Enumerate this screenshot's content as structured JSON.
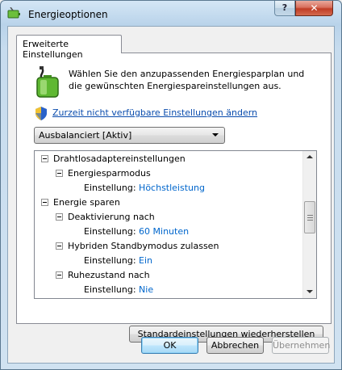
{
  "window": {
    "title": "Energieoptionen",
    "help_label": "?",
    "close_label": "✕"
  },
  "tab": {
    "label": "Erweiterte Einstellungen"
  },
  "description": "Wählen Sie den anzupassenden Energiesparplan und die gewünschten Energiespareinstellungen aus.",
  "change_settings_link": "Zurzeit nicht verfügbare Einstellungen ändern",
  "plan_select": {
    "value": "Ausbalanciert [Aktiv]"
  },
  "tree": {
    "rows": [
      {
        "label": "Drahtlosadaptereinstellungen"
      },
      {
        "label": "Energiesparmodus"
      },
      {
        "label": "Einstellung:",
        "value": "Höchstleistung"
      },
      {
        "label": "Energie sparen"
      },
      {
        "label": "Deaktivierung nach"
      },
      {
        "label": "Einstellung:",
        "value": "60 Minuten"
      },
      {
        "label": "Hybriden Standbymodus zulassen"
      },
      {
        "label": "Einstellung:",
        "value": "Ein"
      },
      {
        "label": "Ruhezustand nach"
      },
      {
        "label": "Einstellung:",
        "value": "Nie"
      }
    ]
  },
  "buttons": {
    "restore": "Standardeinstellungen wiederherstellen",
    "ok": "OK",
    "cancel": "Abbrechen",
    "apply": "Übernehmen"
  },
  "colors": {
    "link": "#0a4cad",
    "value": "#0066cc",
    "close": "#c03c24"
  }
}
